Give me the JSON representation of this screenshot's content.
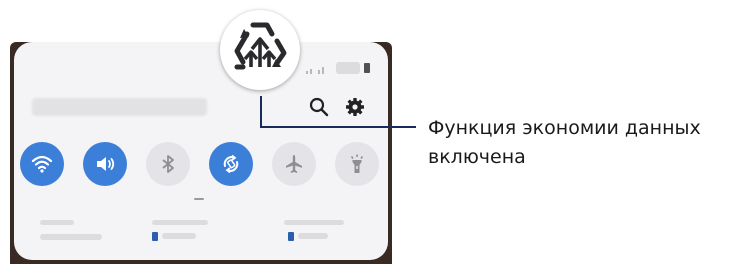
{
  "callout": {
    "line1": "Функция экономии данных",
    "line2": "включена",
    "line_color": "#1a2a5a"
  },
  "quick_panel": {
    "header_icons": [
      "search-icon",
      "gear-icon"
    ],
    "toggles": [
      {
        "icon": "wifi-icon",
        "state": "on"
      },
      {
        "icon": "sound-icon",
        "state": "on"
      },
      {
        "icon": "bluetooth-icon",
        "state": "off"
      },
      {
        "icon": "auto-rotate-icon",
        "state": "on"
      },
      {
        "icon": "airplane-mode-icon",
        "state": "off"
      },
      {
        "icon": "flashlight-icon",
        "state": "off"
      }
    ],
    "colors": {
      "active": "#3b7fd8",
      "inactive": "#e4e4e8",
      "panel": "#f4f4f6"
    }
  },
  "zoomed_icon": "data-saver-icon"
}
